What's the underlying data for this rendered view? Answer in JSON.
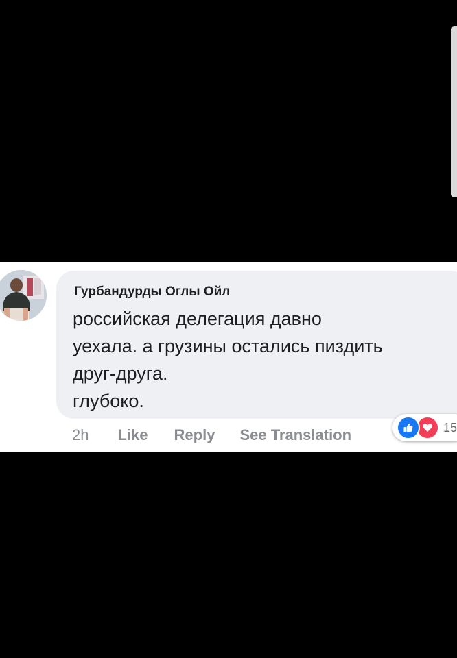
{
  "comment": {
    "author": "Гурбандурды Оглы Ойл",
    "lines": [
      "российская делегация давно",
      "уехала. а грузины остались пиздить",
      "друг-друга.",
      "глубоко."
    ],
    "time": "2h",
    "actions": {
      "like": "Like",
      "reply": "Reply",
      "translate": "See Translation"
    },
    "reactions": {
      "icons": [
        "thumbs-up-icon",
        "heart-icon"
      ],
      "count": "15"
    }
  },
  "colors": {
    "background": "#000000",
    "card": "#ffffff",
    "bubble": "#eef0f3",
    "like_blue": "#1877f2",
    "love_red": "#f33e58",
    "meta_gray": "#8a8d91"
  }
}
